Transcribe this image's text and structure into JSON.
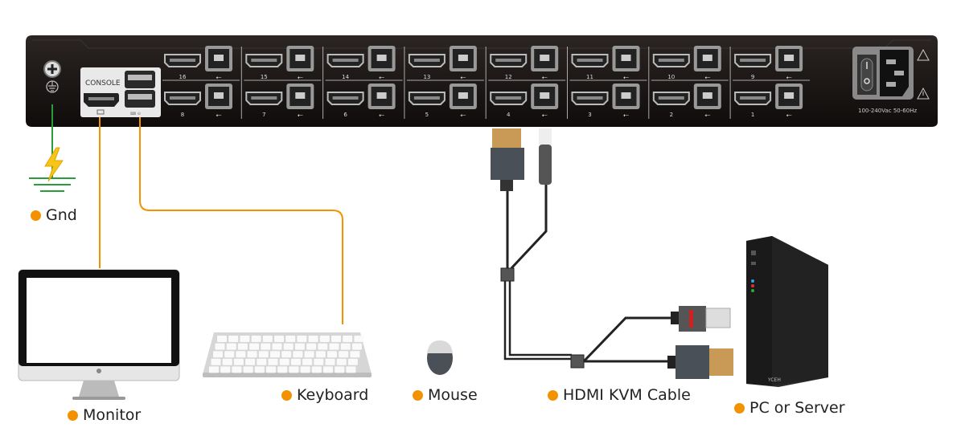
{
  "kvm_panel": {
    "console_label": "CONSOLE",
    "power_rating": "100-240Vac 50-60Hz",
    "top_row_ports": [
      "16",
      "15",
      "14",
      "13",
      "12",
      "11",
      "10",
      "9"
    ],
    "bottom_row_ports": [
      "8",
      "7",
      "6",
      "5",
      "4",
      "3",
      "2",
      "1"
    ]
  },
  "pc_brand": "YCEH",
  "labels": {
    "gnd": "Gnd",
    "monitor": "Monitor",
    "keyboard": "Keyboard",
    "mouse": "Mouse",
    "cable": "HDMI KVM Cable",
    "pc": "PC or Server"
  },
  "colors": {
    "label_dot": "#f39200",
    "console_lines": "#f39200",
    "ground_line": "#2a9d3a",
    "panel": "#1b1716",
    "lightning": "#f5c518"
  }
}
